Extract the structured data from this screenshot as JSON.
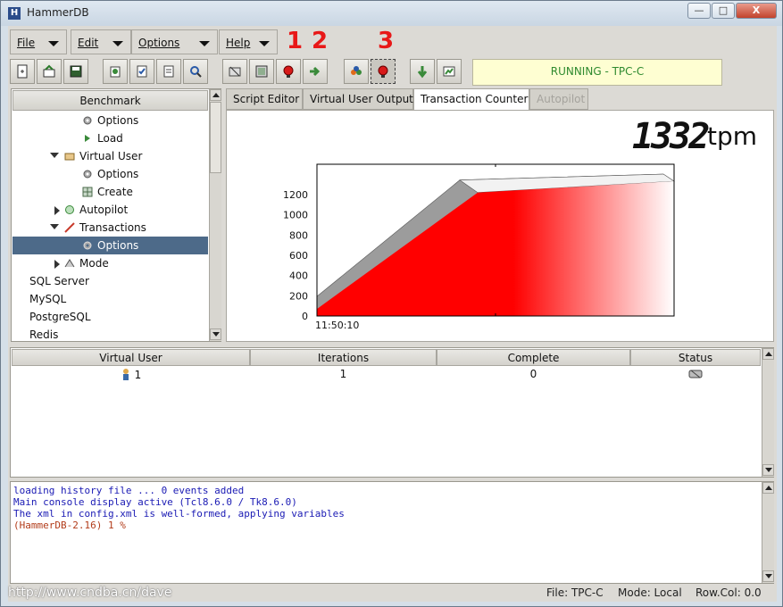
{
  "window": {
    "title": "HammerDB",
    "min_glyph": "—",
    "max_glyph": "□",
    "close_glyph": "X"
  },
  "menus": [
    {
      "label": "File"
    },
    {
      "label": "Edit"
    },
    {
      "label": "Options"
    },
    {
      "label": "Help"
    }
  ],
  "toolbar": {
    "icons": [
      "new-script-icon",
      "open-file-icon",
      "save-file-icon",
      "benchmark-icon",
      "options-icon",
      "report-icon",
      "search-icon",
      "build-schema-icon",
      "load-driver-icon",
      "stop-icon",
      "run-icon",
      "create-users-icon",
      "stop-users-icon",
      "transaction-counter-icon",
      "metrics-icon"
    ],
    "status": "RUNNING - TPC-C"
  },
  "annotations": {
    "n1": "1",
    "n2": "2",
    "n3": "3",
    "color": "#e81818"
  },
  "tree": {
    "header": "Benchmark",
    "rows": [
      {
        "label": "Options",
        "icon": "gear-icon"
      },
      {
        "label": "Load",
        "icon": "arrow-right-icon"
      },
      {
        "label": "Virtual User",
        "icon": "folder-icon"
      },
      {
        "label": "Options",
        "icon": "gear-icon"
      },
      {
        "label": "Create",
        "icon": "grid-icon"
      },
      {
        "label": "Autopilot",
        "icon": "autopilot-icon"
      },
      {
        "label": "Transactions",
        "icon": "pencil-icon"
      },
      {
        "label": "Options",
        "icon": "gear-icon"
      },
      {
        "label": "Mode",
        "icon": "mode-icon"
      },
      {
        "label": "SQL Server"
      },
      {
        "label": "MySQL"
      },
      {
        "label": "PostgreSQL"
      },
      {
        "label": "Redis"
      }
    ]
  },
  "tabs": [
    {
      "label": "Script Editor"
    },
    {
      "label": "Virtual User Output"
    },
    {
      "label": "Transaction Counter"
    },
    {
      "label": "Autopilot"
    }
  ],
  "counter": {
    "value": "1332",
    "unit": "tpm"
  },
  "chart_data": {
    "type": "area",
    "x": [
      "11:50:10",
      "",
      ""
    ],
    "series": [
      {
        "values": [
          70,
          1220,
          1332
        ],
        "color": "#ff0000"
      }
    ],
    "ylim": [
      0,
      1500
    ],
    "yticks": [
      "0",
      "200",
      "400",
      "600",
      "800",
      "1000",
      "1200"
    ],
    "xticks": [
      "11:50:10"
    ],
    "grid": false
  },
  "table": {
    "columns": [
      "Virtual User",
      "Iterations",
      "Complete",
      "Status"
    ],
    "rows": [
      {
        "vu": "1",
        "iterations": "1",
        "complete": "0",
        "status_icon": "running-status-icon"
      }
    ]
  },
  "console": {
    "lines": [
      "loading history file ... 0 events added",
      "Main console display active (Tcl8.6.0 / Tk8.6.0)",
      "The xml in config.xml is well-formed, applying variables",
      "(HammerDB-2.16) 1 %"
    ]
  },
  "footer": {
    "watermark": "http://www.cndba.cn/dave",
    "file": "File: TPC-C",
    "mode": "Mode: Local",
    "rowcol": "Row.Col:  0.0"
  }
}
